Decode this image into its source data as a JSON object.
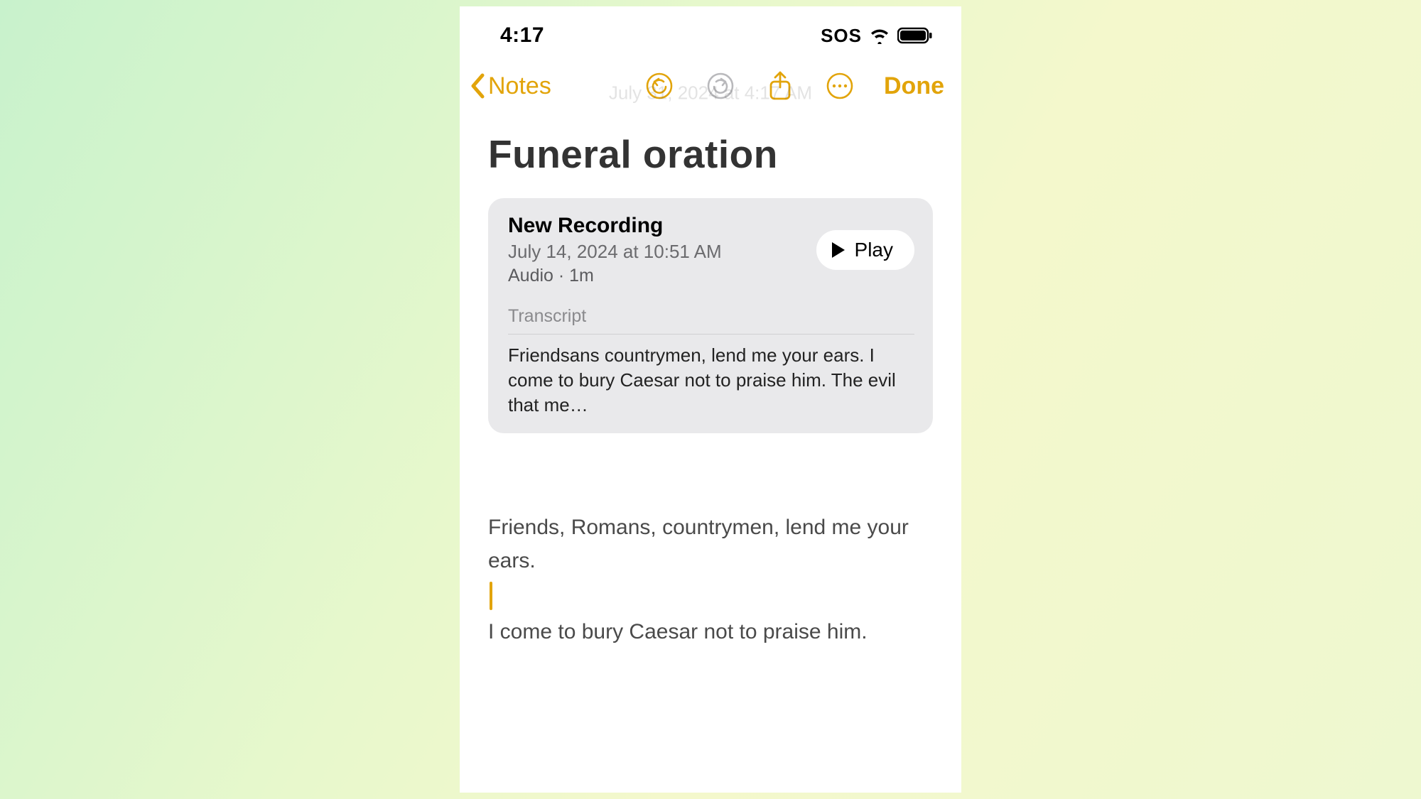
{
  "status": {
    "time": "4:17",
    "sos": "SOS"
  },
  "nav": {
    "back_label": "Notes",
    "done_label": "Done",
    "ghost_date": "July 31, 2024 at 4:17 AM"
  },
  "note": {
    "title": "Funeral oration"
  },
  "recording": {
    "title": "New Recording",
    "date": "July 14, 2024 at 10:51 AM",
    "meta": "Audio · 1m",
    "play_label": "Play",
    "transcript_label": "Transcript",
    "transcript_preview": "Friendsans countrymen, lend me your ears. I come to bury Caesar not to praise him. The evil that me…"
  },
  "body": {
    "para1": "Friends, Romans, countrymen, lend me your ears.",
    "para2": "I come to bury Caesar not to praise him."
  },
  "colors": {
    "accent": "#e2a40a"
  }
}
